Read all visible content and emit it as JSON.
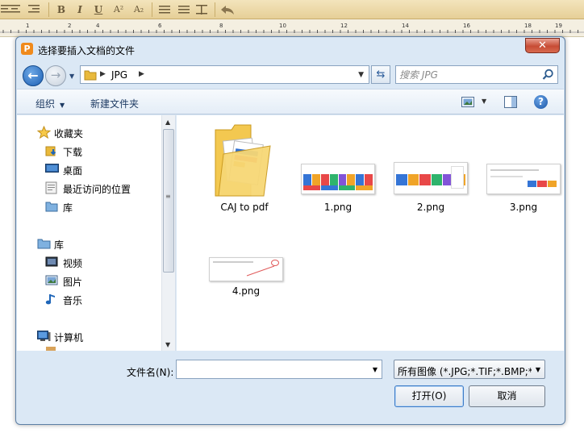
{
  "dialog": {
    "title": "选择要插入文档的文件",
    "app_icon_glyph": "P",
    "close_glyph": "✕"
  },
  "editor_toolbar": {
    "bold": "B",
    "italic": "I",
    "underline": "U",
    "superscript": "A²",
    "subscript": "A₂"
  },
  "ruler": {
    "numbers": [
      "1",
      "2",
      "4",
      "6",
      "8",
      "10",
      "12",
      "14",
      "16",
      "18",
      "19"
    ]
  },
  "address_bar": {
    "path": [
      "JPG"
    ]
  },
  "search": {
    "placeholder": "搜索 JPG"
  },
  "command_bar": {
    "organize": "组织",
    "new_folder": "新建文件夹"
  },
  "nav_pane": {
    "favorites": {
      "label": "收藏夹",
      "items": [
        "下载",
        "桌面",
        "最近访问的位置",
        "库"
      ]
    },
    "libraries": {
      "label": "库",
      "items": [
        "视频",
        "图片",
        "音乐"
      ]
    },
    "computer": {
      "label": "计算机"
    }
  },
  "files": [
    {
      "name": "CAJ to pdf",
      "type": "folder"
    },
    {
      "name": "1.png",
      "type": "image"
    },
    {
      "name": "2.png",
      "type": "image"
    },
    {
      "name": "3.png",
      "type": "image"
    },
    {
      "name": "4.png",
      "type": "image"
    }
  ],
  "bottom": {
    "filename_label": "文件名(N):",
    "filename_value": "",
    "filetype_value": "所有图像 (*.JPG;*.TIF;*.BMP;*.I",
    "open_button": "打开(O)",
    "cancel_button": "取消"
  },
  "colors": {
    "dialog_frame": "#dbe8f5",
    "close_button": "#c74c35",
    "back_button": "#1b5fb4",
    "toolbar_bg": "#e6cf97",
    "folder_yellow": "#f3c850"
  }
}
